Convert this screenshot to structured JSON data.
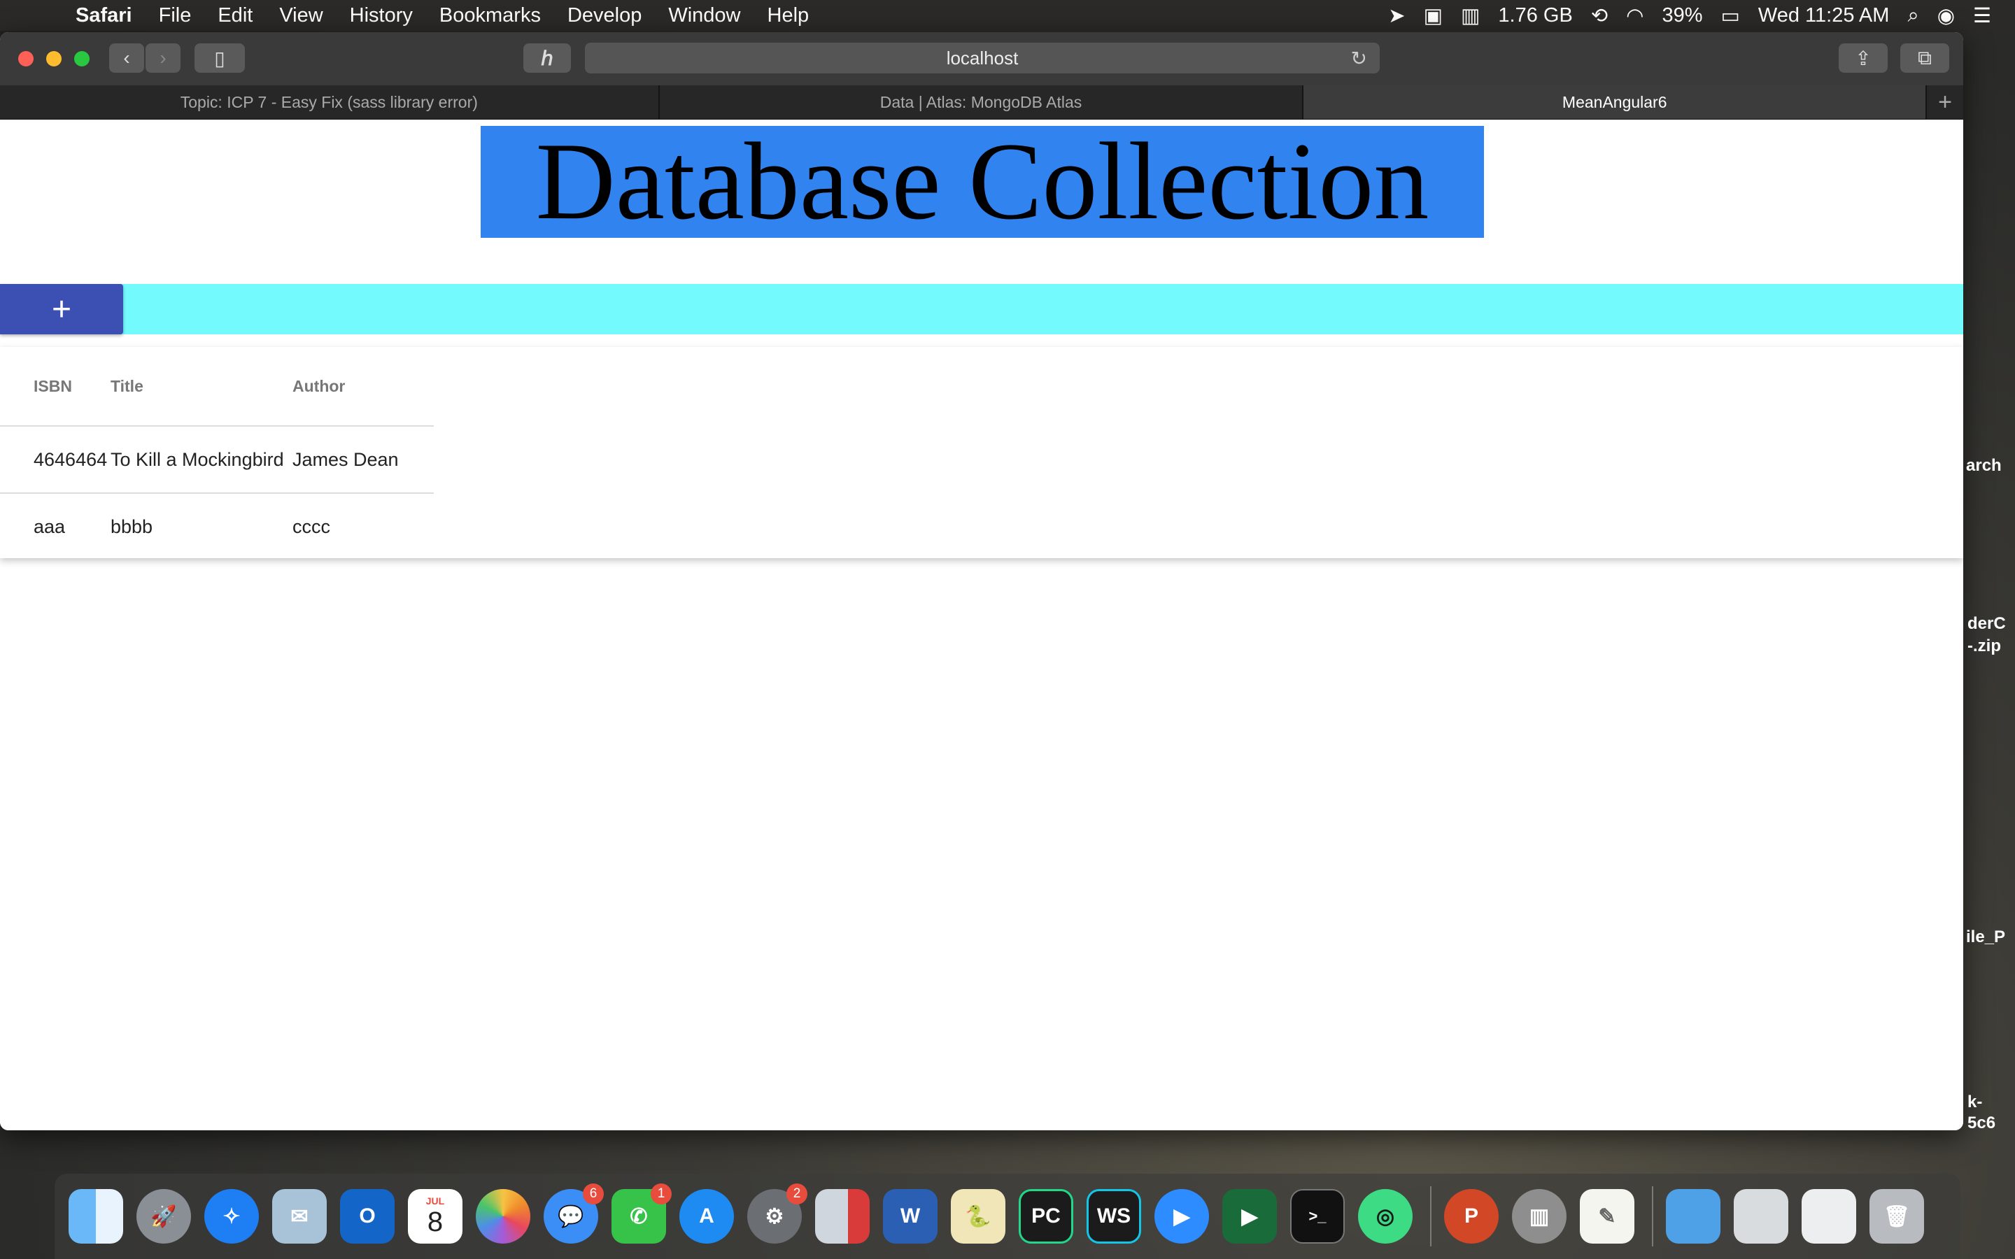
{
  "menubar": {
    "app": "Safari",
    "items": [
      "File",
      "Edit",
      "View",
      "History",
      "Bookmarks",
      "Develop",
      "Window",
      "Help"
    ],
    "memory": "1.76 GB",
    "battery": "39%",
    "clock": "Wed 11:25 AM"
  },
  "browser": {
    "url": "localhost",
    "tabs": [
      {
        "label": "Topic: ICP 7 - Easy Fix (sass library error)"
      },
      {
        "label": "Data | Atlas: MongoDB Atlas"
      },
      {
        "label": "MeanAngular6"
      }
    ],
    "new_tab": "+"
  },
  "page": {
    "heading": "Database Collection",
    "add_button": "+",
    "table": {
      "headers": [
        "ISBN",
        "Title",
        "Author"
      ],
      "rows": [
        [
          "4646464",
          "To Kill a Mockingbird",
          "James Dean"
        ],
        [
          "aaa",
          "bbbb",
          "cccc"
        ]
      ]
    }
  },
  "desktop_labels": [
    "arch",
    "derC",
    "-.zip",
    "ile_P",
    "k-",
    "5c6"
  ],
  "dock": {
    "badges": {
      "messages": "6",
      "facetime": "1",
      "preferences": "2"
    },
    "calendar": {
      "month": "JUL",
      "day": "8"
    }
  }
}
